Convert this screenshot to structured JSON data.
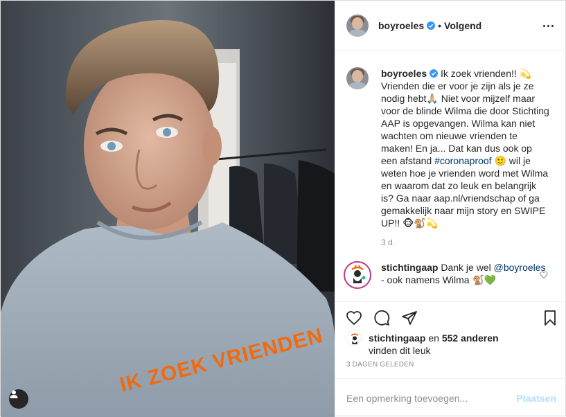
{
  "post": {
    "author": {
      "username": "boyroeles",
      "follow_status": "Volgend",
      "separator": "•"
    },
    "shirt_text": "IK ZOEK VRIENDEN",
    "caption": {
      "username": "boyroeles",
      "text_1": "Ik zoek vrienden!! 💫 Vrienden die er voor je zijn als je ze nodig hebt🙏🏼 Niet voor mijzelf maar voor de blinde Wilma die door Stichting AAP is opgevangen. Wilma kan niet wachten om nieuwe vrienden te maken! En ja... Dat kan dus ook op een afstand ",
      "hashtag": "#coronaproof",
      "text_2": " 🙂 wil je weten hoe je vrienden word met Wilma en waarom dat zo leuk en belangrijk is? Ga naar aap.nl/vriendschap of ga gemakkelijk naar mijn story en SWIPE UP!! 🐵🐒💫",
      "timestamp": "3 d."
    },
    "reply": {
      "username": "stichtingaap",
      "text_1": "Dank je wel ",
      "mention": "@boyroeles",
      "text_2": " - ook namens Wilma 🐒💚"
    },
    "likes": {
      "username": "stichtingaap",
      "connector": " en ",
      "count": "552 anderen",
      "suffix": "vinden dit leuk"
    },
    "date_label": "3 DAGEN GELEDEN",
    "comment_input": {
      "placeholder": "Een opmerking toevoegen...",
      "value": ""
    },
    "post_button": "Plaatsen"
  },
  "icons": {
    "verified": "verified-badge-icon",
    "more": "more-options-icon",
    "like": "heart-icon",
    "comment": "comment-bubble-icon",
    "share": "paper-plane-icon",
    "save": "bookmark-icon",
    "tag": "user-tag-icon"
  },
  "colors": {
    "link": "#00376b",
    "verified": "#3897f0",
    "muted": "#8e8e8e",
    "post_button_disabled": "#b2dffc",
    "shirt_print": "#f26a0f"
  }
}
